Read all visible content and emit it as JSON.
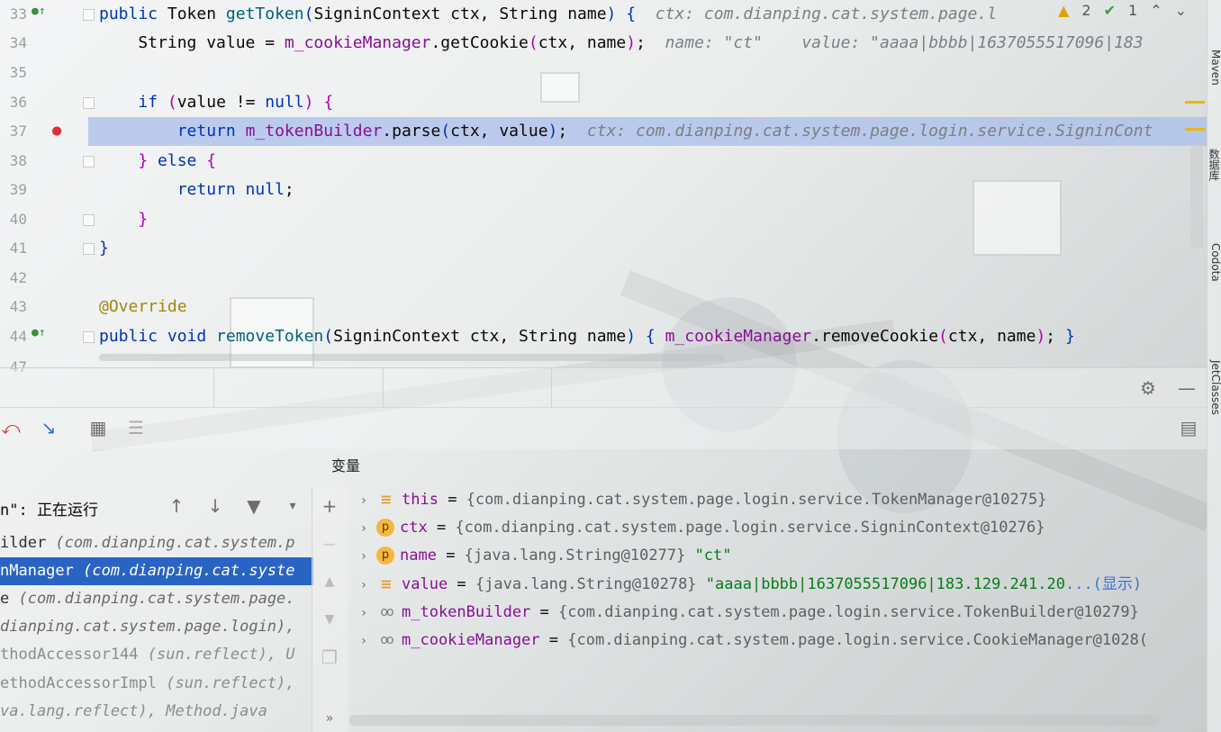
{
  "editor": {
    "status": {
      "warnings": "2",
      "checks": "1"
    },
    "lines": [
      {
        "num": "33",
        "tokens": [
          [
            "kw",
            "public "
          ],
          [
            "",
            "Token "
          ],
          [
            "fn",
            "getToken"
          ],
          [
            "br1",
            "("
          ],
          [
            "",
            "SigninContext ctx, String name"
          ],
          [
            "br1",
            ") "
          ],
          [
            "br1",
            "{"
          ],
          [
            "hint",
            "  ctx: com.dianping.cat.system.page.l"
          ]
        ]
      },
      {
        "num": "34",
        "tokens": [
          [
            "",
            "    String value = "
          ],
          [
            "fld",
            "m_cookieManager"
          ],
          [
            "",
            ".getCookie"
          ],
          [
            "br2",
            "("
          ],
          [
            "",
            "ctx, name"
          ],
          [
            "br2",
            ")"
          ],
          [
            "",
            ";"
          ],
          [
            "hint",
            "  name: \"ct\"    value: \"aaaa|bbbb|1637055517096|183"
          ]
        ]
      },
      {
        "num": "35",
        "tokens": []
      },
      {
        "num": "36",
        "tokens": [
          [
            "",
            "    "
          ],
          [
            "kw",
            "if "
          ],
          [
            "br2",
            "("
          ],
          [
            "",
            "value != "
          ],
          [
            "kw",
            "null"
          ],
          [
            "br2",
            ") "
          ],
          [
            "br2",
            "{"
          ]
        ]
      },
      {
        "num": "37",
        "tokens": [
          [
            "",
            "        "
          ],
          [
            "kw",
            "return "
          ],
          [
            "fld",
            "m_tokenBuilder"
          ],
          [
            "",
            ".parse"
          ],
          [
            "br1",
            "("
          ],
          [
            "",
            "ctx, value"
          ],
          [
            "br1",
            ")"
          ],
          [
            "",
            ";"
          ],
          [
            "hint",
            "  ctx: com.dianping.cat.system.page.login.service.SigninCont"
          ]
        ]
      },
      {
        "num": "38",
        "tokens": [
          [
            "",
            "    "
          ],
          [
            "br2",
            "} "
          ],
          [
            "kw",
            "else "
          ],
          [
            "br2",
            "{"
          ]
        ]
      },
      {
        "num": "39",
        "tokens": [
          [
            "",
            "        "
          ],
          [
            "kw",
            "return null"
          ],
          [
            "",
            ";"
          ]
        ]
      },
      {
        "num": "40",
        "tokens": [
          [
            "",
            "    "
          ],
          [
            "br2",
            "}"
          ]
        ]
      },
      {
        "num": "41",
        "tokens": [
          [
            "br1",
            "}"
          ]
        ]
      },
      {
        "num": "42",
        "tokens": []
      },
      {
        "num": "43",
        "tokens": [
          [
            "ann",
            "@Override"
          ]
        ]
      },
      {
        "num": "44",
        "tokens": [
          [
            "kw",
            "public void "
          ],
          [
            "fn",
            "removeToken"
          ],
          [
            "br1",
            "("
          ],
          [
            "",
            "SigninContext ctx, String name"
          ],
          [
            "br1",
            ") "
          ],
          [
            "br1",
            "{ "
          ],
          [
            "fld",
            "m_cookieManager"
          ],
          [
            "",
            ".removeCookie"
          ],
          [
            "br2",
            "("
          ],
          [
            "",
            "ctx, name"
          ],
          [
            "br2",
            ")"
          ],
          [
            "",
            "; "
          ],
          [
            "br1",
            "}"
          ]
        ]
      },
      {
        "num": "47",
        "tokens": []
      }
    ]
  },
  "right_strip": {
    "tab1": "Maven",
    "tab2": "数据库",
    "tab3": "Codota",
    "tab4": "JetClasses"
  },
  "debug": {
    "variables_title": "变量",
    "thread_label": "n\": 正在运行",
    "frames": [
      {
        "name": "ilder ",
        "pkg": "(com.dianping.cat.system.p",
        "state": "normal"
      },
      {
        "name": "nManager ",
        "pkg": "(com.dianping.cat.syste",
        "state": "selected"
      },
      {
        "name": "e ",
        "pkg": "(com.dianping.cat.system.page.",
        "state": "normal"
      },
      {
        "name": "",
        "pkg": "dianping.cat.system.page.login), ",
        "state": "normal"
      },
      {
        "name": "thodAccessor144 ",
        "pkg": "(sun.reflect), U",
        "state": "dim"
      },
      {
        "name": "ethodAccessorImpl ",
        "pkg": "(sun.reflect), ",
        "state": "dim"
      },
      {
        "name": "",
        "pkg": "va.lang.reflect), Method.java",
        "state": "dim"
      }
    ],
    "variables": [
      {
        "icon": "field",
        "name": "this",
        "type": "{com.dianping.cat.system.page.login.service.TokenManager@10275}",
        "value": "",
        "more": ""
      },
      {
        "icon": "param",
        "name": "ctx",
        "type": "{com.dianping.cat.system.page.login.service.SigninContext@10276}",
        "value": "",
        "more": ""
      },
      {
        "icon": "param",
        "name": "name",
        "type": "{java.lang.String@10277}",
        "value": "\"ct\"",
        "more": ""
      },
      {
        "icon": "field",
        "name": "value",
        "type": "{java.lang.String@10278}",
        "value": "\"aaaa|bbbb|1637055517096|183.129.241.20",
        "more": "...(显示)"
      },
      {
        "icon": "obj",
        "name": "m_tokenBuilder",
        "type": "{com.dianping.cat.system.page.login.service.TokenBuilder@10279}",
        "value": "",
        "more": ""
      },
      {
        "icon": "obj",
        "name": "m_cookieManager",
        "type": "{com.dianping.cat.system.page.login.service.CookieManager@1028(",
        "value": "",
        "more": ""
      }
    ]
  }
}
